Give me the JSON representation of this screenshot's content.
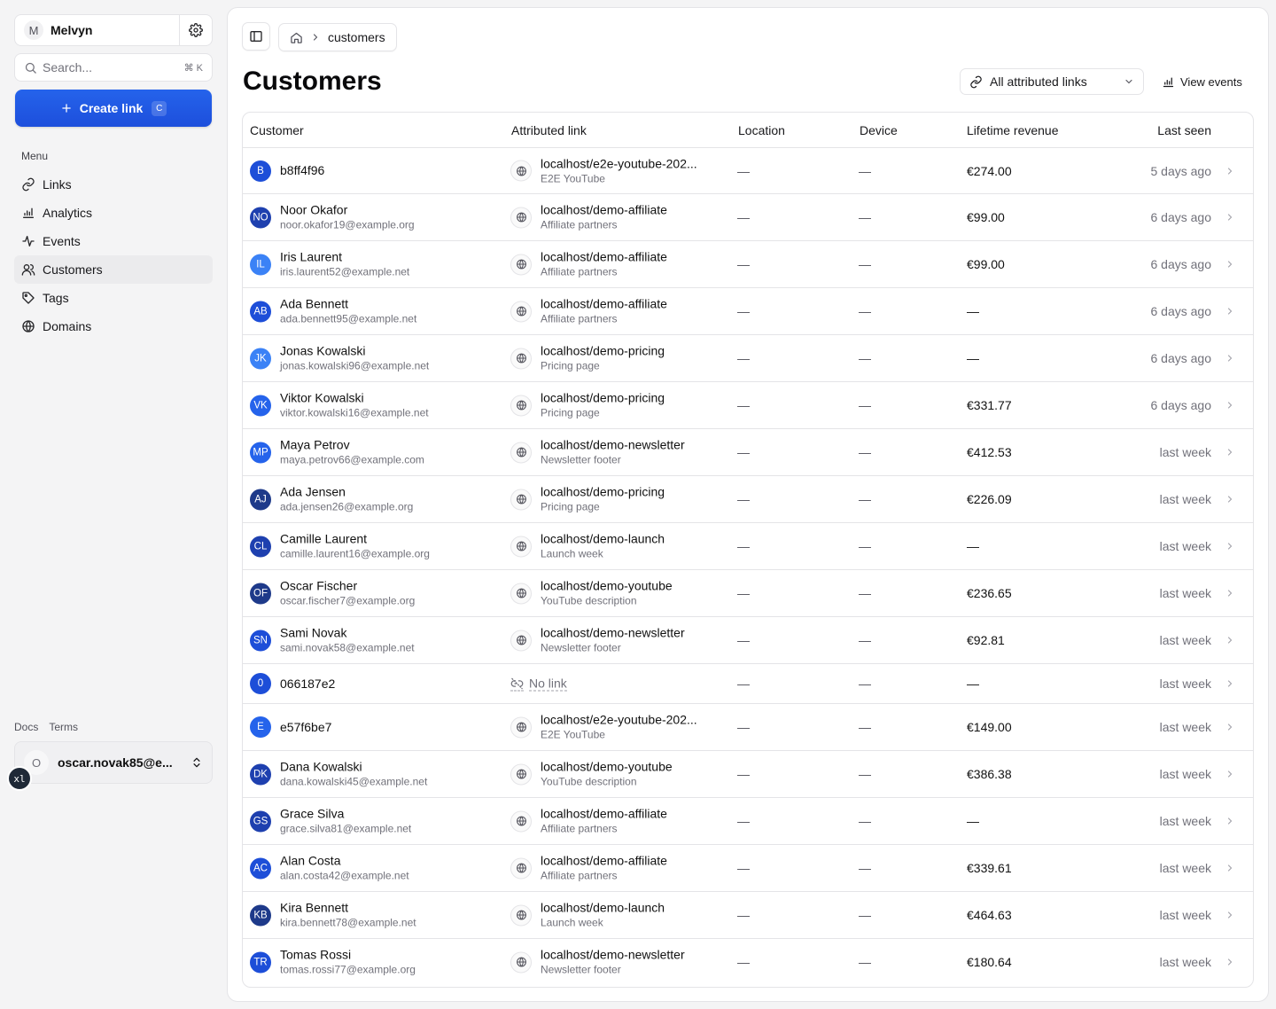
{
  "sidebar": {
    "workspace": {
      "initial": "M",
      "name": "Melvyn"
    },
    "search": {
      "placeholder": "Search...",
      "shortcut": "⌘ K"
    },
    "create": {
      "label": "Create link",
      "shortcut": "C"
    },
    "menu_label": "Menu",
    "items": [
      {
        "label": "Links",
        "icon": "link-icon"
      },
      {
        "label": "Analytics",
        "icon": "analytics-icon"
      },
      {
        "label": "Events",
        "icon": "activity-icon"
      },
      {
        "label": "Customers",
        "icon": "users-icon",
        "active": true
      },
      {
        "label": "Tags",
        "icon": "tag-icon"
      },
      {
        "label": "Domains",
        "icon": "globe-icon"
      }
    ],
    "footer_links": [
      "Docs",
      "Terms"
    ],
    "user": {
      "initial": "O",
      "name": "oscar.novak85@e..."
    },
    "badge": "xl"
  },
  "header": {
    "breadcrumb": "customers",
    "title": "Customers",
    "filter": "All attributed links",
    "view_events": "View events"
  },
  "table": {
    "columns": [
      "Customer",
      "Attributed link",
      "Location",
      "Device",
      "Lifetime revenue",
      "Last seen"
    ],
    "rows": [
      {
        "initials": "B",
        "name": "b8ff4f96",
        "email": "",
        "url": "localhost/e2e-youtube-202...",
        "sub": "E2E YouTube",
        "location": "—",
        "device": "—",
        "revenue": "€274.00",
        "seen": "5 days ago",
        "color": "#1d4ed8"
      },
      {
        "initials": "NO",
        "name": "Noor Okafor",
        "email": "noor.okafor19@example.org",
        "url": "localhost/demo-affiliate",
        "sub": "Affiliate partners",
        "location": "—",
        "device": "—",
        "revenue": "€99.00",
        "seen": "6 days ago",
        "color": "#1e40af"
      },
      {
        "initials": "IL",
        "name": "Iris Laurent",
        "email": "iris.laurent52@example.net",
        "url": "localhost/demo-affiliate",
        "sub": "Affiliate partners",
        "location": "—",
        "device": "—",
        "revenue": "€99.00",
        "seen": "6 days ago",
        "color": "#3b82f6"
      },
      {
        "initials": "AB",
        "name": "Ada Bennett",
        "email": "ada.bennett95@example.net",
        "url": "localhost/demo-affiliate",
        "sub": "Affiliate partners",
        "location": "—",
        "device": "—",
        "revenue": "—",
        "seen": "6 days ago",
        "color": "#1d4ed8"
      },
      {
        "initials": "JK",
        "name": "Jonas Kowalski",
        "email": "jonas.kowalski96@example.net",
        "url": "localhost/demo-pricing",
        "sub": "Pricing page",
        "location": "—",
        "device": "—",
        "revenue": "—",
        "seen": "6 days ago",
        "color": "#3b82f6"
      },
      {
        "initials": "VK",
        "name": "Viktor Kowalski",
        "email": "viktor.kowalski16@example.net",
        "url": "localhost/demo-pricing",
        "sub": "Pricing page",
        "location": "—",
        "device": "—",
        "revenue": "€331.77",
        "seen": "6 days ago",
        "color": "#2563eb"
      },
      {
        "initials": "MP",
        "name": "Maya Petrov",
        "email": "maya.petrov66@example.com",
        "url": "localhost/demo-newsletter",
        "sub": "Newsletter footer",
        "location": "—",
        "device": "—",
        "revenue": "€412.53",
        "seen": "last week",
        "color": "#2563eb"
      },
      {
        "initials": "AJ",
        "name": "Ada Jensen",
        "email": "ada.jensen26@example.org",
        "url": "localhost/demo-pricing",
        "sub": "Pricing page",
        "location": "—",
        "device": "—",
        "revenue": "€226.09",
        "seen": "last week",
        "color": "#1e3a8a"
      },
      {
        "initials": "CL",
        "name": "Camille Laurent",
        "email": "camille.laurent16@example.org",
        "url": "localhost/demo-launch",
        "sub": "Launch week",
        "location": "—",
        "device": "—",
        "revenue": "—",
        "seen": "last week",
        "color": "#1e40af"
      },
      {
        "initials": "OF",
        "name": "Oscar Fischer",
        "email": "oscar.fischer7@example.org",
        "url": "localhost/demo-youtube",
        "sub": "YouTube description",
        "location": "—",
        "device": "—",
        "revenue": "€236.65",
        "seen": "last week",
        "color": "#1e3a8a"
      },
      {
        "initials": "SN",
        "name": "Sami Novak",
        "email": "sami.novak58@example.net",
        "url": "localhost/demo-newsletter",
        "sub": "Newsletter footer",
        "location": "—",
        "device": "—",
        "revenue": "€92.81",
        "seen": "last week",
        "color": "#1d4ed8"
      },
      {
        "initials": "0",
        "name": "066187e2",
        "email": "",
        "url": "",
        "sub": "",
        "nolink": "No link",
        "location": "—",
        "device": "—",
        "revenue": "—",
        "seen": "last week",
        "color": "#1d4ed8"
      },
      {
        "initials": "E",
        "name": "e57f6be7",
        "email": "",
        "url": "localhost/e2e-youtube-202...",
        "sub": "E2E YouTube",
        "location": "—",
        "device": "—",
        "revenue": "€149.00",
        "seen": "last week",
        "color": "#2563eb"
      },
      {
        "initials": "DK",
        "name": "Dana Kowalski",
        "email": "dana.kowalski45@example.net",
        "url": "localhost/demo-youtube",
        "sub": "YouTube description",
        "location": "—",
        "device": "—",
        "revenue": "€386.38",
        "seen": "last week",
        "color": "#1e40af"
      },
      {
        "initials": "GS",
        "name": "Grace Silva",
        "email": "grace.silva81@example.net",
        "url": "localhost/demo-affiliate",
        "sub": "Affiliate partners",
        "location": "—",
        "device": "—",
        "revenue": "—",
        "seen": "last week",
        "color": "#1e40af"
      },
      {
        "initials": "AC",
        "name": "Alan Costa",
        "email": "alan.costa42@example.net",
        "url": "localhost/demo-affiliate",
        "sub": "Affiliate partners",
        "location": "—",
        "device": "—",
        "revenue": "€339.61",
        "seen": "last week",
        "color": "#1d4ed8"
      },
      {
        "initials": "KB",
        "name": "Kira Bennett",
        "email": "kira.bennett78@example.net",
        "url": "localhost/demo-launch",
        "sub": "Launch week",
        "location": "—",
        "device": "—",
        "revenue": "€464.63",
        "seen": "last week",
        "color": "#1e3a8a"
      },
      {
        "initials": "TR",
        "name": "Tomas Rossi",
        "email": "tomas.rossi77@example.org",
        "url": "localhost/demo-newsletter",
        "sub": "Newsletter footer",
        "location": "—",
        "device": "—",
        "revenue": "€180.64",
        "seen": "last week",
        "color": "#1d4ed8"
      }
    ]
  }
}
